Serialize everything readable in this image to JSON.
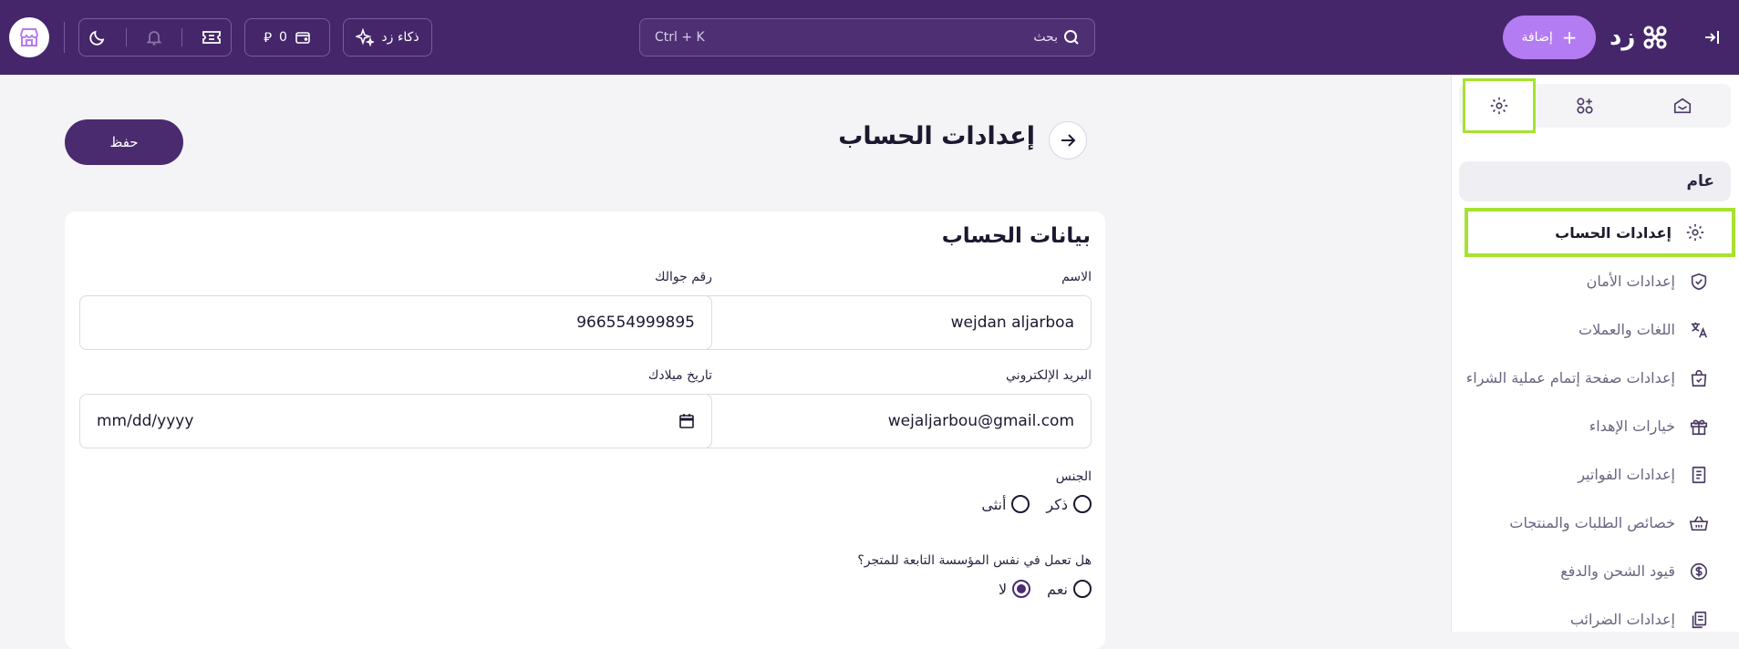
{
  "topbar": {
    "logo_text": "زد",
    "add_label": "إضافة",
    "search_placeholder": "بحث",
    "search_shortcut": "Ctrl + K",
    "ai_label": "ذكاء زد",
    "wallet_balance": "0",
    "currency_symbol": "⃁"
  },
  "sidebar": {
    "section_title": "عام",
    "items": [
      {
        "label": "إعدادات الحساب",
        "icon": "gear-icon",
        "active": true
      },
      {
        "label": "إعدادات الأمان",
        "icon": "shield-check-icon"
      },
      {
        "label": "اللغات والعملات",
        "icon": "translate-icon"
      },
      {
        "label": "إعدادات صفحة إتمام عملية الشراء",
        "icon": "shopping-bag-icon"
      },
      {
        "label": "خيارات الإهداء",
        "icon": "gift-icon"
      },
      {
        "label": "إعدادات الفواتير",
        "icon": "invoice-icon"
      },
      {
        "label": "خصائص الطلبات والمنتجات",
        "icon": "basket-icon"
      },
      {
        "label": "قيود الشحن والدفع",
        "icon": "dollar-circle-icon"
      },
      {
        "label": "إعدادات الضرائب",
        "icon": "tax-docs-icon"
      }
    ]
  },
  "page": {
    "title": "إعدادات الحساب",
    "save_label": "حفظ"
  },
  "form": {
    "section_title": "بيانات الحساب",
    "name_label": "الاسم",
    "name_value": "wejdan aljarboa",
    "phone_label": "رقم جوالك",
    "phone_value": "966554999895",
    "email_label": "البريد الإلكتروني",
    "email_value": "wejaljarbou@gmail.com",
    "birth_label": "تاريخ ميلادك",
    "birth_placeholder": "mm/dd/yyyy",
    "gender_label": "الجنس",
    "gender_male": "ذكر",
    "gender_female": "أنثى",
    "same_org_label": "هل تعمل في نفس المؤسسة التابعة للمتجر؟",
    "same_org_yes": "نعم",
    "same_org_no": "لا",
    "same_org_selected": "لا"
  },
  "colors": {
    "topbar": "#45266a",
    "accent": "#b47cf2",
    "primary": "#4a2b6f",
    "highlight": "#a6e22e"
  }
}
